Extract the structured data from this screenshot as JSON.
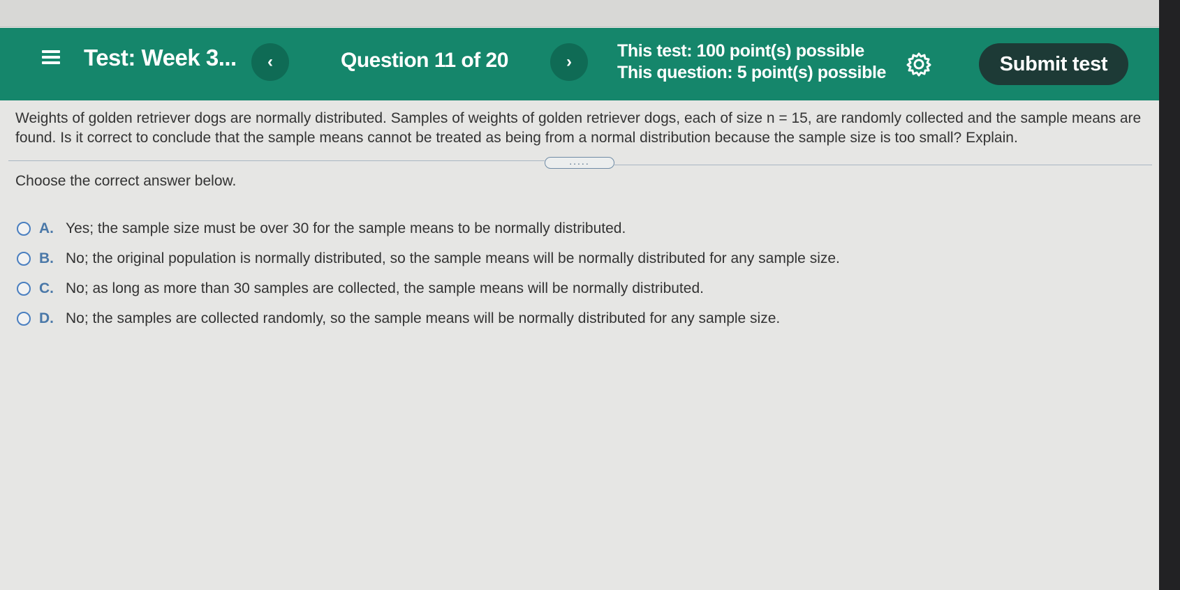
{
  "header": {
    "test_title": "Test:  Week 3...",
    "question_counter": "Question 11 of 20",
    "test_points": "This test: 100 point(s) possible",
    "question_points": "This question: 5 point(s) possible",
    "submit_label": "Submit test",
    "prev_label": "‹",
    "next_label": "›",
    "theme_color": "#15866b"
  },
  "question": {
    "text": "Weights of golden retriever dogs are normally distributed. Samples of weights of golden retriever dogs, each of size n = 15, are randomly collected and the sample means are found. Is it correct to conclude that the sample means cannot be treated as being from a normal distribution because the sample size is too small? Explain.",
    "divider_handle": ".....",
    "instruction": "Choose the correct answer below."
  },
  "options": [
    {
      "letter": "A.",
      "text": "Yes; the sample size must be over 30 for the sample means to be normally distributed."
    },
    {
      "letter": "B.",
      "text": "No; the original population is normally distributed, so the sample means will be normally distributed for any sample size."
    },
    {
      "letter": "C.",
      "text": "No; as long as more than 30 samples are collected, the sample means will be normally distributed."
    },
    {
      "letter": "D.",
      "text": "No; the samples are collected randomly, so the sample means will be normally distributed for any sample size."
    }
  ],
  "icons": {
    "menu": "hamburger-menu-icon",
    "settings": "gear-icon",
    "radio": "radio-unselected-icon"
  }
}
